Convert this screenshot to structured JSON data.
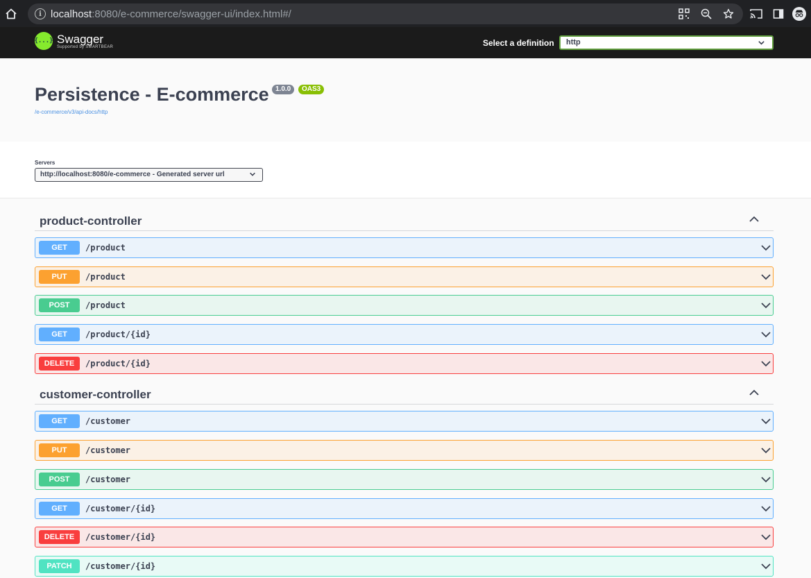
{
  "browser": {
    "url_host": "localhost",
    "url_rest": ":8080/e-commerce/swagger-ui/index.html#/"
  },
  "topbar": {
    "logo_name": "Swagger",
    "logo_sub": "Supported by SMARTBEAR",
    "logo_glyph": "{...}",
    "definition_label": "Select a definition",
    "definition_value": "http"
  },
  "info": {
    "title": "Persistence - E-commerce",
    "version": "1.0.0",
    "oas": "OAS3",
    "spec_link": "/e-commerce/v3/api-docs/http"
  },
  "servers": {
    "label": "Servers",
    "selected": "http://localhost:8080/e-commerce - Generated server url"
  },
  "tags": [
    {
      "name": "product-controller",
      "ops": [
        {
          "method": "GET",
          "path": "/product"
        },
        {
          "method": "PUT",
          "path": "/product"
        },
        {
          "method": "POST",
          "path": "/product"
        },
        {
          "method": "GET",
          "path": "/product/{id}"
        },
        {
          "method": "DELETE",
          "path": "/product/{id}"
        }
      ]
    },
    {
      "name": "customer-controller",
      "ops": [
        {
          "method": "GET",
          "path": "/customer"
        },
        {
          "method": "PUT",
          "path": "/customer"
        },
        {
          "method": "POST",
          "path": "/customer"
        },
        {
          "method": "GET",
          "path": "/customer/{id}"
        },
        {
          "method": "DELETE",
          "path": "/customer/{id}"
        },
        {
          "method": "PATCH",
          "path": "/customer/{id}"
        }
      ]
    }
  ],
  "colors": {
    "get": "#61affe",
    "put": "#fca130",
    "post": "#49cc90",
    "delete": "#f93e3e",
    "patch": "#50e3c2"
  }
}
